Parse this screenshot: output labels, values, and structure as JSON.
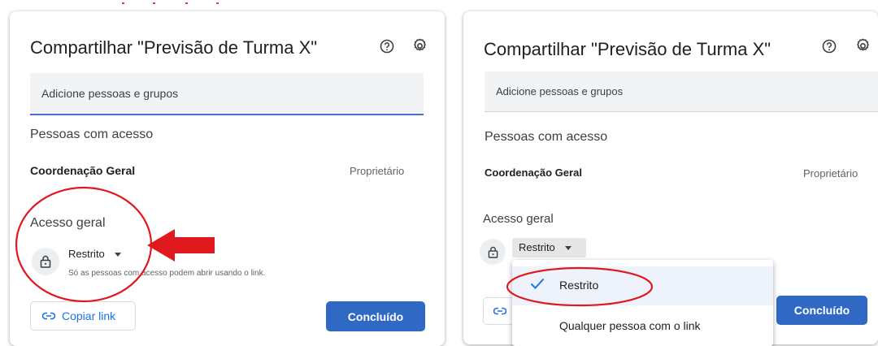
{
  "dialog": {
    "title": "Compartilhar \"Previsão de Turma X\"",
    "help_icon": "help-circle-icon",
    "settings_icon": "gear-icon",
    "add_people_placeholder": "Adicione pessoas e grupos",
    "people_section_title": "Pessoas com acesso",
    "owner_name": "Coordenação Geral",
    "owner_role": "Proprietário",
    "general_access_title": "Acesso geral",
    "access_value": "Restrito",
    "access_help": "Só as pessoas com acesso podem abrir usando o link.",
    "copy_link_label": "Copiar link",
    "copy_link_icon": "link-icon",
    "done_label": "Concluído",
    "lock_icon": "lock-icon"
  },
  "access_menu": {
    "options": [
      {
        "label": "Restrito",
        "selected": true
      },
      {
        "label": "Qualquer pessoa com o link",
        "selected": false
      }
    ]
  },
  "colors": {
    "accent_blue": "#2f69c4",
    "link_blue": "#1a73e8",
    "annotation_red": "#e0191f"
  }
}
